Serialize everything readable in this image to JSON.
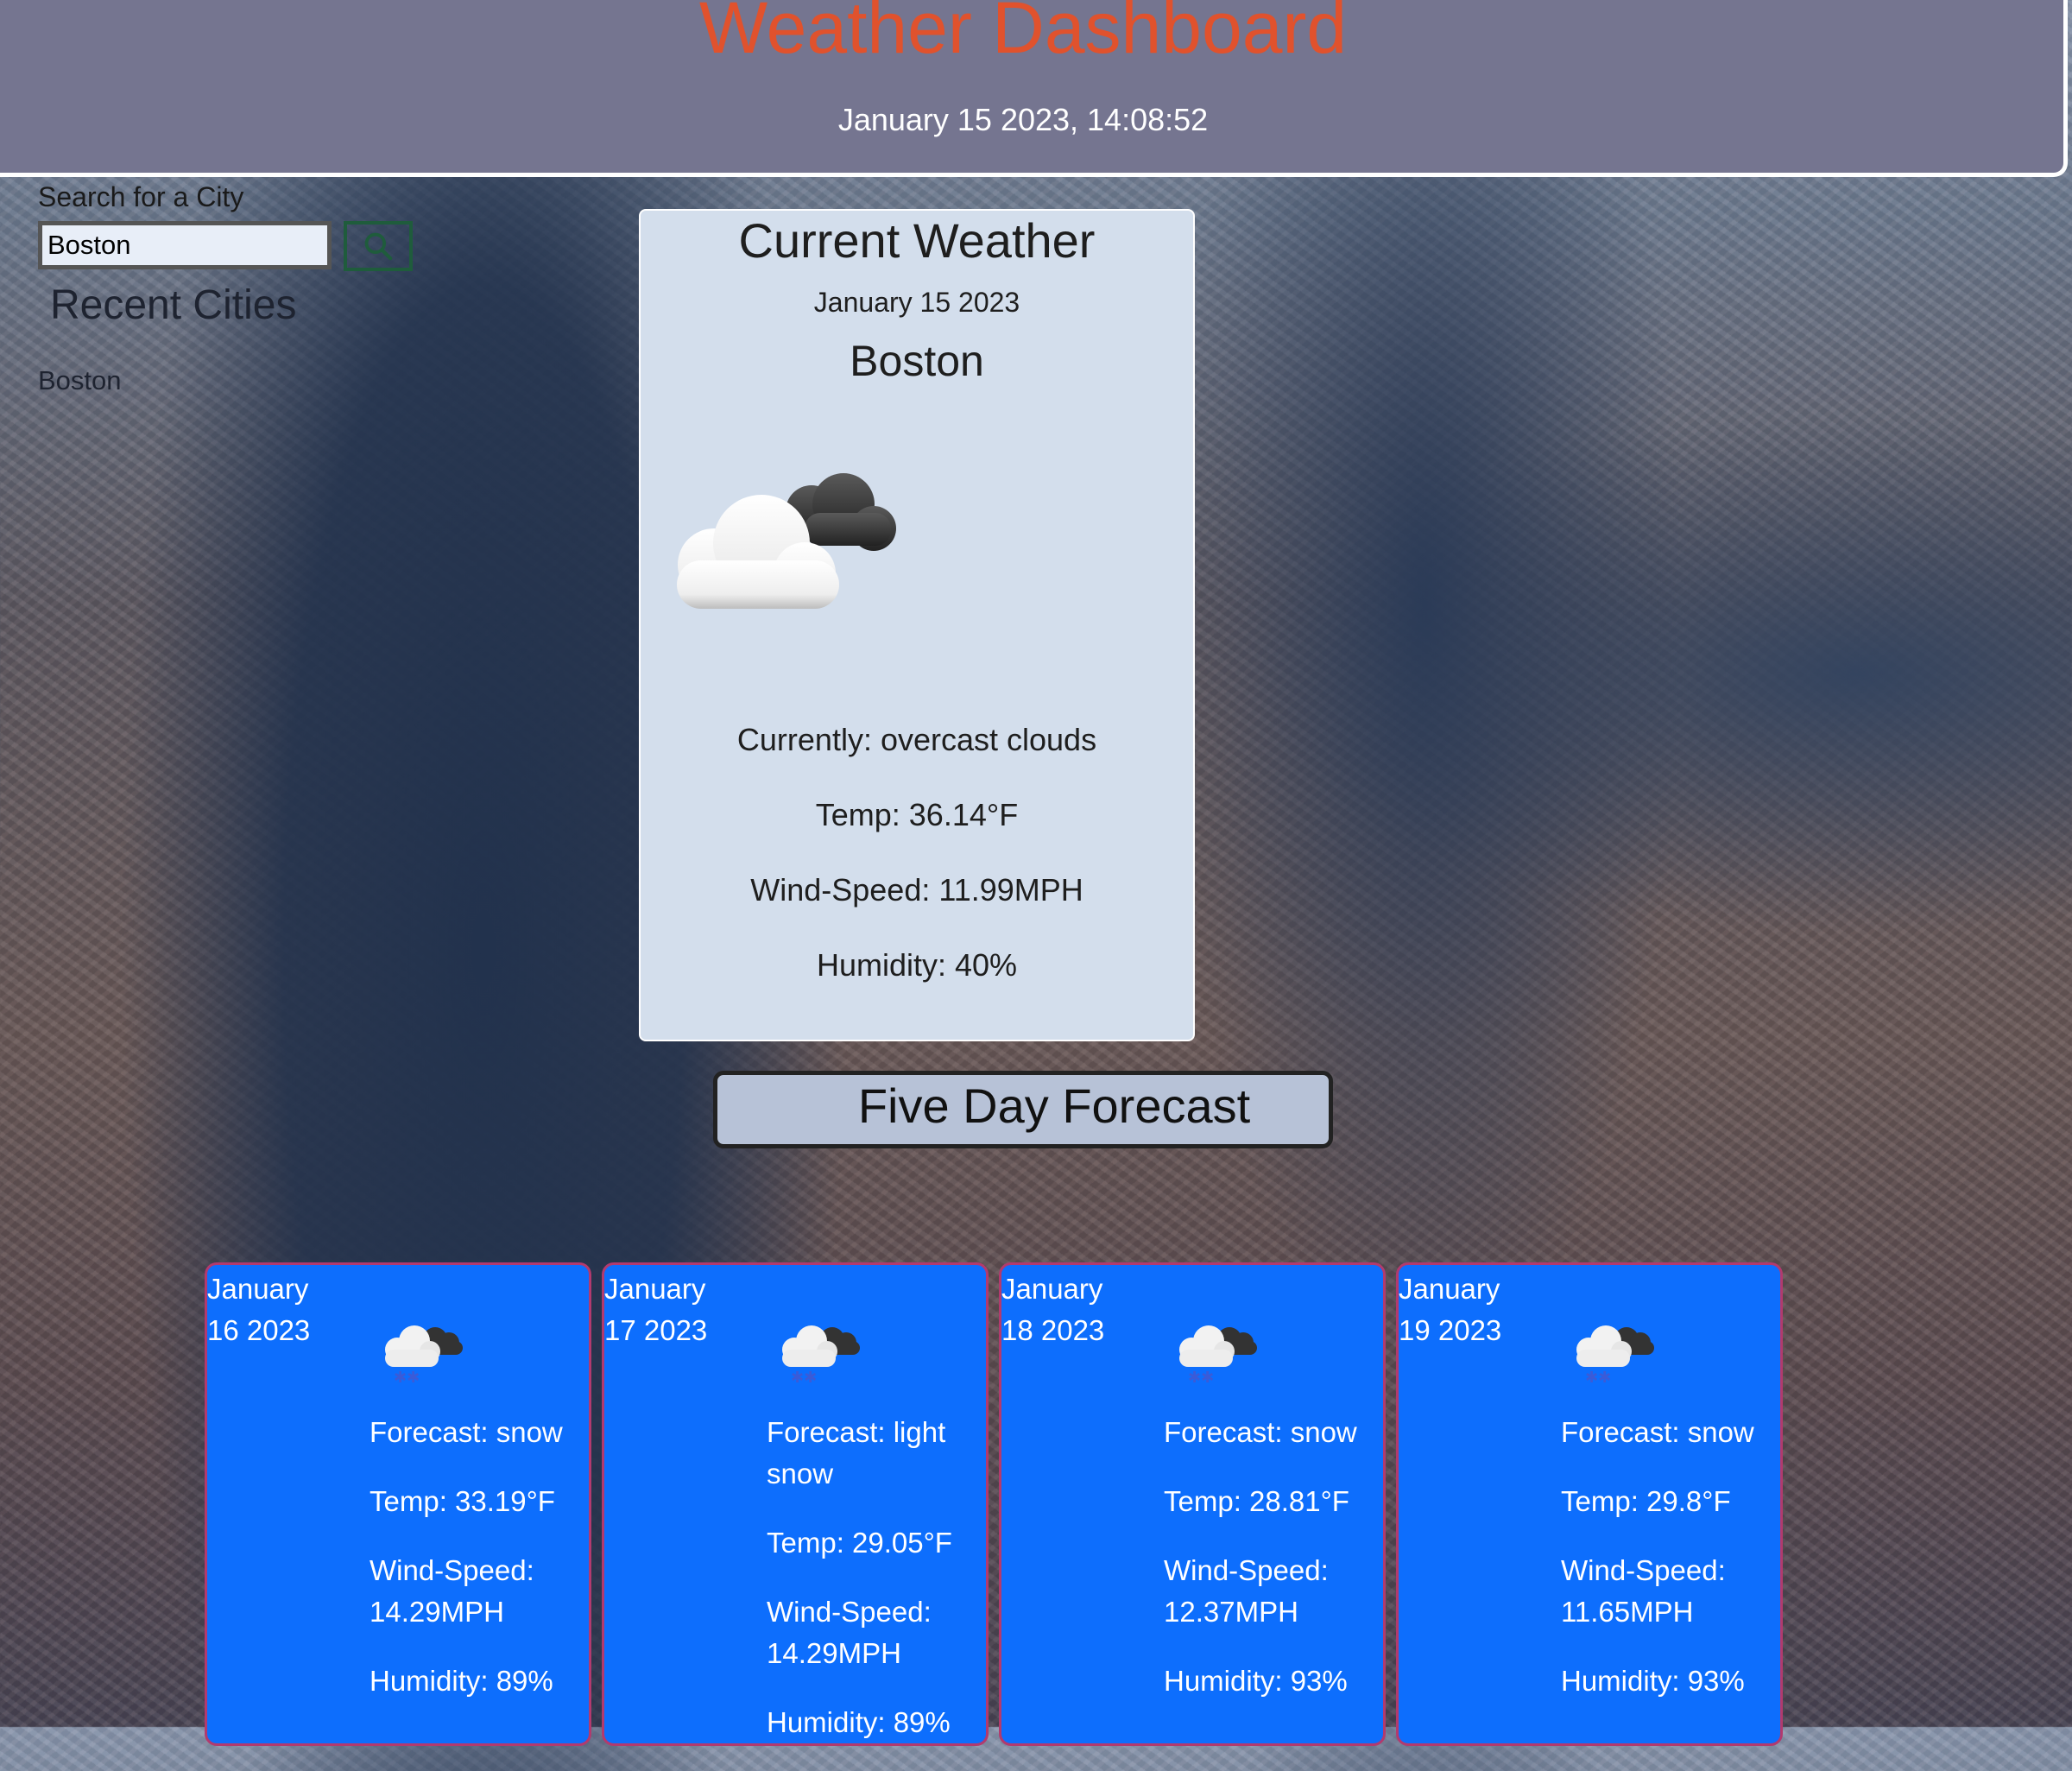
{
  "header": {
    "title": "Weather Dashboard",
    "datetime": "January 15 2023, 14:08:52"
  },
  "search": {
    "label": "Search for a City",
    "value": "Boston",
    "button_icon": "search-icon"
  },
  "recent": {
    "title": "Recent Cities",
    "items": [
      "Boston"
    ]
  },
  "current": {
    "title": "Current Weather",
    "date": "January 15 2023",
    "city": "Boston",
    "icon": "overcast-clouds-icon",
    "description": "Currently: overcast clouds",
    "temp": "Temp: 36.14°F",
    "wind": "Wind-Speed: 11.99MPH",
    "humidity": "Humidity: 40%"
  },
  "forecast": {
    "title": "Five Day Forecast",
    "days": [
      {
        "date": "January 16 2023",
        "icon": "snow-cloud-icon",
        "forecast": "Forecast: snow",
        "temp": "Temp: 33.19°F",
        "wind": "Wind-Speed: 14.29MPH",
        "humidity": "Humidity: 89%"
      },
      {
        "date": "January 17 2023",
        "icon": "snow-cloud-icon",
        "forecast": "Forecast: light snow",
        "temp": "Temp: 29.05°F",
        "wind": "Wind-Speed: 14.29MPH",
        "humidity": "Humidity: 89%"
      },
      {
        "date": "January 18 2023",
        "icon": "snow-cloud-icon",
        "forecast": "Forecast: snow",
        "temp": "Temp: 28.81°F",
        "wind": "Wind-Speed: 12.37MPH",
        "humidity": "Humidity: 93%"
      },
      {
        "date": "January 19 2023",
        "icon": "snow-cloud-icon",
        "forecast": "Forecast: snow",
        "temp": "Temp: 29.8°F",
        "wind": "Wind-Speed: 11.65MPH",
        "humidity": "Humidity: 93%"
      }
    ]
  },
  "colors": {
    "header_bg": "#757590",
    "title_color": "#e0522d",
    "current_card_bg": "#d3deec",
    "forecast_card_bg": "#0d6efd",
    "forecast_card_border": "#b23a6e",
    "search_button_border": "#1f5c3c"
  }
}
